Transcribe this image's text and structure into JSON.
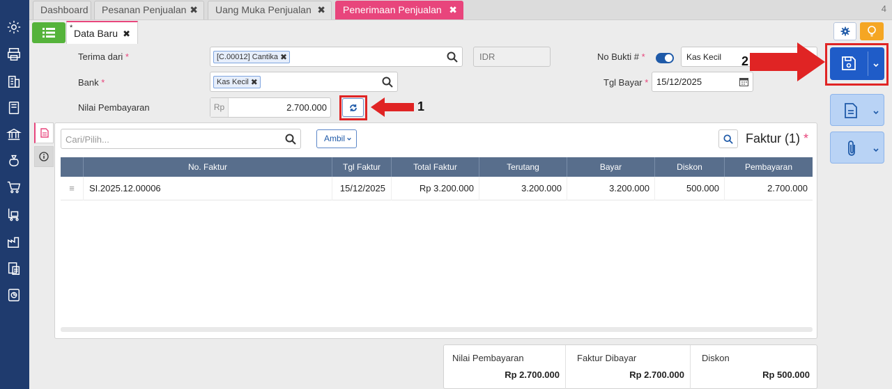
{
  "tabs": [
    {
      "label": "Dashboard",
      "closable": false
    },
    {
      "label": "Pesanan Penjualan",
      "closable": true
    },
    {
      "label": "Uang Muka Penjualan",
      "closable": true
    },
    {
      "label": "Penerimaan Penjualan",
      "closable": true,
      "active": true
    }
  ],
  "tab_count": "4",
  "sub_tab": {
    "marker": "*",
    "label": "Data Baru"
  },
  "form": {
    "terima_dari_label": "Terima dari",
    "terima_dari_tag": "[C.00012] Cantika",
    "currency": "IDR",
    "bank_label": "Bank",
    "bank_tag": "Kas Kecil",
    "nilai_label": "Nilai Pembayaran",
    "nilai_prefix": "Rp",
    "nilai_value": "2.700.000",
    "no_bukti_label": "No Bukti #",
    "no_bukti_value": "Kas Kecil",
    "tgl_bayar_label": "Tgl Bayar",
    "tgl_bayar_value": "15/12/2025",
    "required_mark": "*"
  },
  "panel": {
    "search_placeholder": "Cari/Pilih...",
    "ambil_label": "Ambil",
    "title": "Faktur (1)",
    "required_mark": "*",
    "columns": [
      "No. Faktur",
      "Tgl Faktur",
      "Total Faktur",
      "Terutang",
      "Bayar",
      "Diskon",
      "Pembayaran"
    ],
    "rows": [
      {
        "no_faktur": "SI.2025.12.00006",
        "tgl_faktur": "15/12/2025",
        "total_faktur": "Rp 3.200.000",
        "terutang": "3.200.000",
        "bayar": "3.200.000",
        "diskon": "500.000",
        "pembayaran": "2.700.000"
      }
    ]
  },
  "summary": {
    "nilai_label": "Nilai Pembayaran",
    "nilai_value": "Rp 2.700.000",
    "faktur_label": "Faktur Dibayar",
    "faktur_value": "Rp 2.700.000",
    "diskon_label": "Diskon",
    "diskon_value": "Rp 500.000"
  },
  "annotations": {
    "step1": "1",
    "step2": "2"
  },
  "colors": {
    "sidebar": "#1f3b6e",
    "accent_pink": "#e8457c",
    "primary": "#1f5cc8",
    "header": "#586e8c",
    "annotation": "#e02424"
  },
  "icons": [
    "gear-icon",
    "printer-icon",
    "building-icon",
    "book-icon",
    "bank-icon",
    "money-bag-icon",
    "cart-icon",
    "cart-check-icon",
    "factory-icon",
    "tax-doc-icon",
    "report-icon"
  ]
}
